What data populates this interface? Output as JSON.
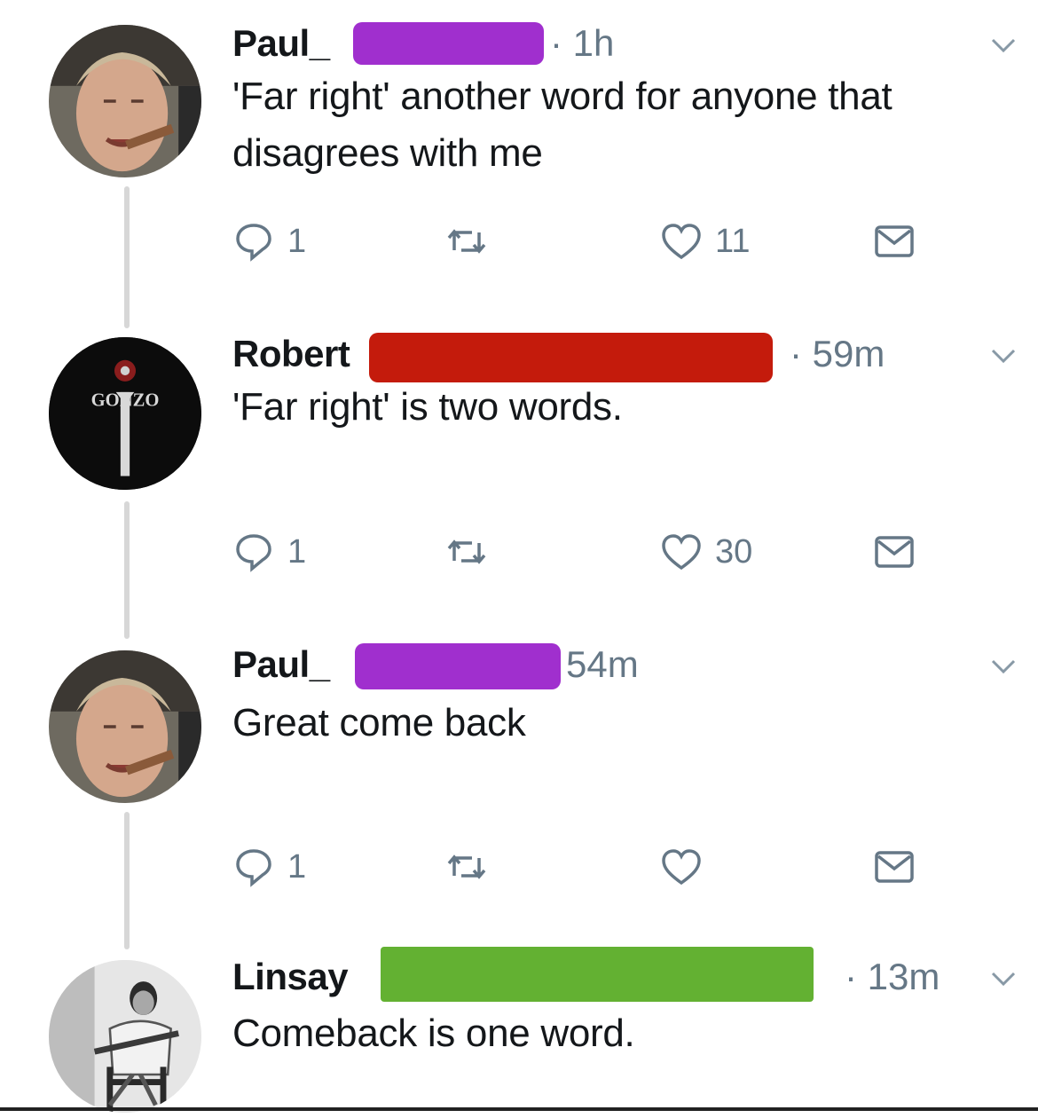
{
  "tweets": [
    {
      "name": "Paul_",
      "time": "· 1h",
      "text": "'Far right' another word for anyone that disagrees with me",
      "reply_count": "1",
      "retweet_count": "",
      "like_count": "11",
      "redact_color": "#a02fce"
    },
    {
      "name": "Robert",
      "time": "· 59m",
      "text": "'Far right' is two words.",
      "reply_count": "1",
      "retweet_count": "",
      "like_count": "30",
      "redact_color": "#c41b0c"
    },
    {
      "name": "Paul_",
      "time": "54m",
      "text": "Great come back",
      "reply_count": "1",
      "retweet_count": "",
      "like_count": "",
      "redact_color": "#a02fce"
    },
    {
      "name": "Linsay",
      "time": "· 13m",
      "text": "Comeback is one word.",
      "redact_color": "#63b132"
    }
  ],
  "icons": {
    "reply": "reply-icon",
    "retweet": "retweet-icon",
    "like": "heart-icon",
    "dm": "envelope-icon",
    "menu": "chevron-down-icon"
  },
  "colors": {
    "muted": "#657786",
    "text": "#14171a",
    "thread_line": "#d7d7d7"
  },
  "avatar_badge_text": "GONZO"
}
